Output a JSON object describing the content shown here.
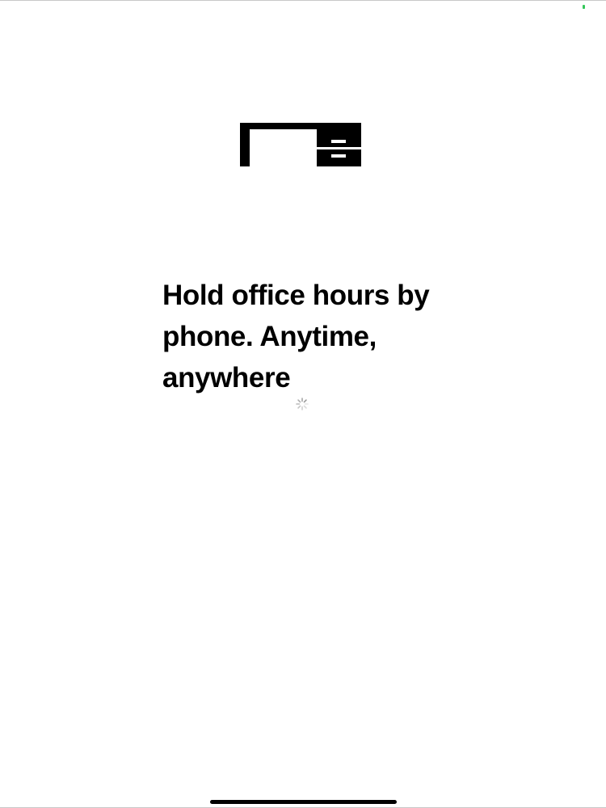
{
  "screen": {
    "headline": "Hold office hours by phone. Anytime, anywhere",
    "icons": {
      "hero": "desk-icon",
      "loading": "loading-spinner-icon",
      "status": "status-indicator-dot"
    },
    "colors": {
      "background": "#ffffff",
      "text": "#000000",
      "status_dot": "#34c759",
      "spinner": "#9a9a9a"
    }
  }
}
